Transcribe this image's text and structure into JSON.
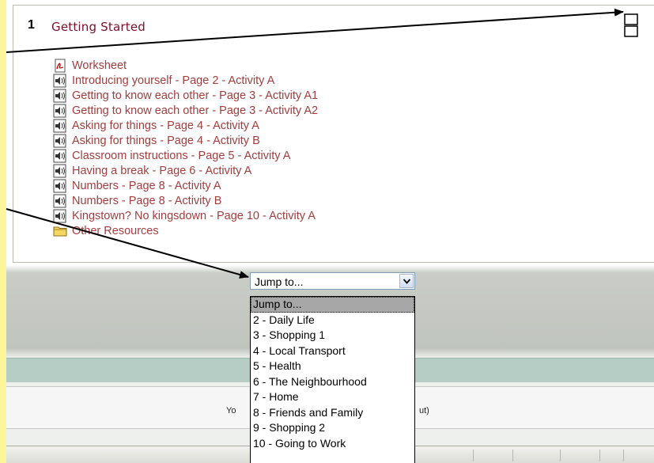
{
  "section": {
    "number": "1",
    "title": "Getting Started",
    "resources": [
      {
        "label": "Worksheet",
        "icon": "pdf-icon"
      },
      {
        "label": "Introducing yourself - Page 2 - Activity A",
        "icon": "audio-icon"
      },
      {
        "label": "Getting to know each other - Page 3 - Activity A1",
        "icon": "audio-icon"
      },
      {
        "label": "Getting to know each other - Page 3 - Activity A2",
        "icon": "audio-icon"
      },
      {
        "label": "Asking for things - Page 4 - Activity A",
        "icon": "audio-icon"
      },
      {
        "label": "Asking for things - Page 4 - Activity B",
        "icon": "audio-icon"
      },
      {
        "label": "Classroom instructions - Page 5 - Activity A",
        "icon": "audio-icon"
      },
      {
        "label": "Having a break - Page 6 - Activity A",
        "icon": "audio-icon"
      },
      {
        "label": "Numbers - Page 8 - Activity A",
        "icon": "audio-icon"
      },
      {
        "label": "Numbers - Page 8 - Activity B",
        "icon": "audio-icon"
      },
      {
        "label": "Kingstown? No kingsdown - Page 10 - Activity A",
        "icon": "audio-icon"
      },
      {
        "label": "Other Resources",
        "icon": "folder-icon"
      }
    ]
  },
  "jump_menu": {
    "selected": "Jump to...",
    "options": [
      "Jump to...",
      "2 - Daily Life",
      "3 - Shopping 1",
      "4 - Local Transport",
      "5 - Health",
      "6 - The Neighbourhood",
      "7 - Home",
      "8 - Friends and Family",
      "9 - Shopping 2",
      "10 - Going to Work"
    ]
  },
  "footer": {
    "left_fragment": "Yo",
    "right_fragment": "ut)"
  },
  "colors": {
    "page_background": "#fdf59a",
    "link": "#a33d3d",
    "section_title": "#7a0f2a",
    "selected_option": "#a7a7a7"
  }
}
